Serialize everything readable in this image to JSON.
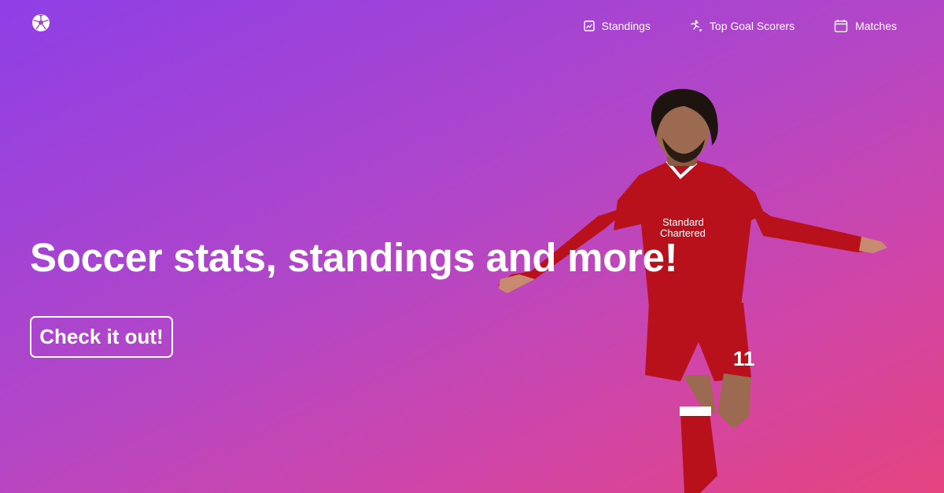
{
  "header": {
    "logo_icon": "soccer-ball-icon",
    "nav": [
      {
        "label": "Standings",
        "icon": "chart-icon"
      },
      {
        "label": "Top Goal Scorers",
        "icon": "kick-icon"
      },
      {
        "label": "Matches",
        "icon": "calendar-icon"
      }
    ]
  },
  "hero": {
    "title": "Soccer stats, standings and more!",
    "cta_label": "Check it out!",
    "image": {
      "shirt_text_1": "Standard",
      "shirt_text_2": "Chartered",
      "number": "11"
    }
  },
  "colors": {
    "gradient_start": "#8e3fe6",
    "gradient_end": "#e5447f",
    "jersey": "#b8111c"
  }
}
